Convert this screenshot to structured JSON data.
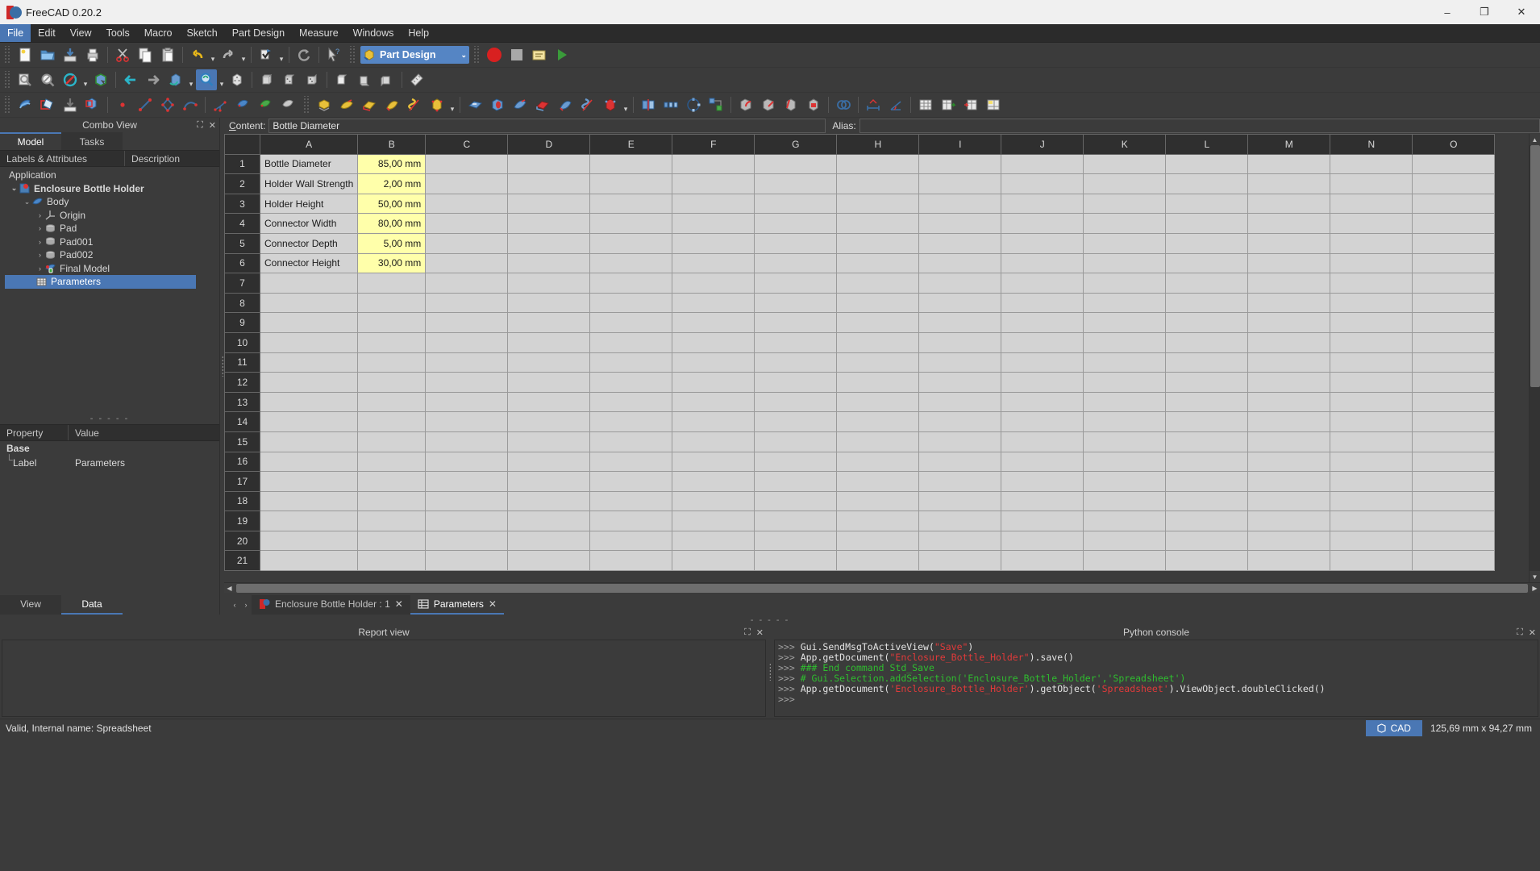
{
  "window": {
    "title": "FreeCAD 0.20.2",
    "app_icon": "freecad-icon",
    "minimize": "–",
    "maximize": "❐",
    "close": "✕"
  },
  "menubar": {
    "items": [
      {
        "label": "File",
        "active": true
      },
      {
        "label": "Edit",
        "active": false
      },
      {
        "label": "View",
        "active": false
      },
      {
        "label": "Tools",
        "active": false
      },
      {
        "label": "Macro",
        "active": false
      },
      {
        "label": "Sketch",
        "active": false
      },
      {
        "label": "Part Design",
        "active": false
      },
      {
        "label": "Measure",
        "active": false
      },
      {
        "label": "Windows",
        "active": false
      },
      {
        "label": "Help",
        "active": false
      }
    ]
  },
  "workbench": {
    "selected": "Part Design",
    "arrow": "⌄"
  },
  "combo_view": {
    "title": "Combo View",
    "float_icon": "restore-icon",
    "close_icon": "close-icon",
    "tabs": [
      {
        "label": "Model",
        "active": true
      },
      {
        "label": "Tasks",
        "active": false
      }
    ],
    "tree_headers": {
      "labels": "Labels & Attributes",
      "description": "Description"
    },
    "tree": [
      {
        "label": "Application",
        "depth": 0,
        "arrow": "",
        "icon": "",
        "bold": false,
        "selected": false
      },
      {
        "label": "Enclosure Bottle Holder",
        "depth": 1,
        "arrow": "⌄",
        "icon": "document-icon",
        "bold": true,
        "selected": false
      },
      {
        "label": "Body",
        "depth": 2,
        "arrow": "⌄",
        "icon": "body-icon",
        "bold": false,
        "selected": false
      },
      {
        "label": "Origin",
        "depth": 3,
        "arrow": "›",
        "icon": "origin-icon",
        "bold": false,
        "selected": false
      },
      {
        "label": "Pad",
        "depth": 3,
        "arrow": "›",
        "icon": "pad-icon",
        "bold": false,
        "selected": false
      },
      {
        "label": "Pad001",
        "depth": 3,
        "arrow": "›",
        "icon": "pad-icon",
        "bold": false,
        "selected": false
      },
      {
        "label": "Pad002",
        "depth": 3,
        "arrow": "›",
        "icon": "pad-icon",
        "bold": false,
        "selected": false
      },
      {
        "label": "Final Model",
        "depth": 3,
        "arrow": "›",
        "icon": "final-model-icon",
        "bold": false,
        "selected": false
      },
      {
        "label": "Parameters",
        "depth": 2,
        "arrow": "",
        "icon": "spreadsheet-icon",
        "bold": false,
        "selected": true
      }
    ],
    "splitter": "- - - - -",
    "property_headers": {
      "property": "Property",
      "value": "Value"
    },
    "properties": [
      {
        "name": "Base",
        "value": "",
        "group": true
      },
      {
        "name": "Label",
        "value": "Parameters",
        "group": false
      }
    ],
    "bottom_tabs": [
      {
        "label": "View",
        "active": false
      },
      {
        "label": "Data",
        "active": true
      }
    ]
  },
  "spreadsheet": {
    "content_label": "Content:",
    "content_value": "Bottle Diameter",
    "alias_label": "Alias:",
    "alias_value": "",
    "columns": [
      "A",
      "B",
      "C",
      "D",
      "E",
      "F",
      "G",
      "H",
      "I",
      "J",
      "K",
      "L",
      "M",
      "N",
      "O"
    ],
    "row_count": 21,
    "rows": [
      {
        "n": "1",
        "a": "Bottle Diameter",
        "b": "85,00 mm"
      },
      {
        "n": "2",
        "a": "Holder Wall Strength",
        "b": "2,00 mm"
      },
      {
        "n": "3",
        "a": "Holder Height",
        "b": "50,00 mm"
      },
      {
        "n": "4",
        "a": "Connector Width",
        "b": "80,00 mm"
      },
      {
        "n": "5",
        "a": "Connector Depth",
        "b": "5,00 mm"
      },
      {
        "n": "6",
        "a": "Connector Height",
        "b": "30,00 mm"
      },
      {
        "n": "7",
        "a": "",
        "b": ""
      },
      {
        "n": "8",
        "a": "",
        "b": ""
      },
      {
        "n": "9",
        "a": "",
        "b": ""
      },
      {
        "n": "10",
        "a": "",
        "b": ""
      },
      {
        "n": "11",
        "a": "",
        "b": ""
      },
      {
        "n": "12",
        "a": "",
        "b": ""
      },
      {
        "n": "13",
        "a": "",
        "b": ""
      },
      {
        "n": "14",
        "a": "",
        "b": ""
      },
      {
        "n": "15",
        "a": "",
        "b": ""
      },
      {
        "n": "16",
        "a": "",
        "b": ""
      },
      {
        "n": "17",
        "a": "",
        "b": ""
      },
      {
        "n": "18",
        "a": "",
        "b": ""
      },
      {
        "n": "19",
        "a": "",
        "b": ""
      },
      {
        "n": "20",
        "a": "",
        "b": ""
      },
      {
        "n": "21",
        "a": "",
        "b": ""
      }
    ],
    "highlight_color": "#ffffaa"
  },
  "document_tabs": {
    "prev_arrow": "‹",
    "next_arrow": "›",
    "items": [
      {
        "label": "Enclosure Bottle Holder : 1",
        "icon": "freecad-doc-icon",
        "close": "✕",
        "active": false
      },
      {
        "label": "Parameters",
        "icon": "spreadsheet-icon",
        "close": "✕",
        "active": true
      }
    ]
  },
  "dock_splitter": "- - - - -",
  "report_view": {
    "title": "Report view",
    "float_icon": "restore-icon",
    "close_icon": "close-icon",
    "lines": []
  },
  "python_console": {
    "title": "Python console",
    "float_icon": "restore-icon",
    "close_icon": "close-icon",
    "lines": [
      {
        "prompt": ">>> ",
        "segments": [
          {
            "t": "Gui.SendMsgToActiveView(",
            "c": "txt"
          },
          {
            "t": "\"Save\"",
            "c": "str"
          },
          {
            "t": ")",
            "c": "txt"
          }
        ]
      },
      {
        "prompt": ">>> ",
        "segments": [
          {
            "t": "App.getDocument(",
            "c": "txt"
          },
          {
            "t": "\"Enclosure_Bottle_Holder\"",
            "c": "str"
          },
          {
            "t": ").save()",
            "c": "txt"
          }
        ]
      },
      {
        "prompt": ">>> ",
        "segments": [
          {
            "t": "### End command Std_Save",
            "c": "cmt"
          }
        ]
      },
      {
        "prompt": ">>> ",
        "segments": [
          {
            "t": "# Gui.Selection.addSelection('Enclosure_Bottle_Holder','Spreadsheet')",
            "c": "cmt"
          }
        ]
      },
      {
        "prompt": ">>> ",
        "segments": [
          {
            "t": "App.getDocument(",
            "c": "txt"
          },
          {
            "t": "'Enclosure_Bottle_Holder'",
            "c": "str"
          },
          {
            "t": ").getObject(",
            "c": "txt"
          },
          {
            "t": "'Spreadsheet'",
            "c": "str"
          },
          {
            "t": ").ViewObject.doubleClicked()",
            "c": "txt"
          }
        ]
      },
      {
        "prompt": ">>> ",
        "segments": []
      }
    ]
  },
  "status_bar": {
    "message": "Valid, Internal name: Spreadsheet",
    "cad_button": "CAD",
    "cad_icon": "navigation-cube-icon",
    "dimensions": "125,69 mm x 94,27 mm"
  },
  "colors": {
    "accent": "#4a77b4",
    "highlight_cell": "#ffffaa",
    "panel_bg": "#3b3b3b",
    "cell_bg": "#d3d3d3"
  }
}
